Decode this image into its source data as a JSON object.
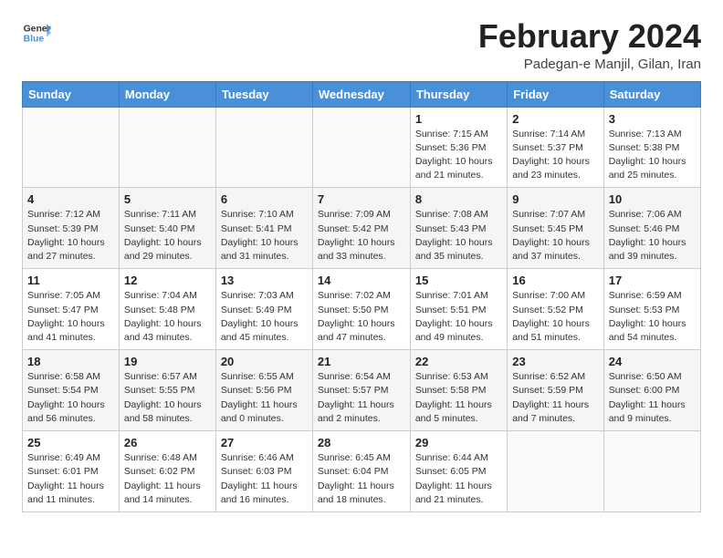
{
  "logo": {
    "general": "General",
    "blue": "Blue"
  },
  "header": {
    "month_year": "February 2024",
    "subtitle": "Padegan-e Manjil, Gilan, Iran"
  },
  "weekdays": [
    "Sunday",
    "Monday",
    "Tuesday",
    "Wednesday",
    "Thursday",
    "Friday",
    "Saturday"
  ],
  "weeks": [
    [
      {
        "day": "",
        "info": ""
      },
      {
        "day": "",
        "info": ""
      },
      {
        "day": "",
        "info": ""
      },
      {
        "day": "",
        "info": ""
      },
      {
        "day": "1",
        "info": "Sunrise: 7:15 AM\nSunset: 5:36 PM\nDaylight: 10 hours\nand 21 minutes."
      },
      {
        "day": "2",
        "info": "Sunrise: 7:14 AM\nSunset: 5:37 PM\nDaylight: 10 hours\nand 23 minutes."
      },
      {
        "day": "3",
        "info": "Sunrise: 7:13 AM\nSunset: 5:38 PM\nDaylight: 10 hours\nand 25 minutes."
      }
    ],
    [
      {
        "day": "4",
        "info": "Sunrise: 7:12 AM\nSunset: 5:39 PM\nDaylight: 10 hours\nand 27 minutes."
      },
      {
        "day": "5",
        "info": "Sunrise: 7:11 AM\nSunset: 5:40 PM\nDaylight: 10 hours\nand 29 minutes."
      },
      {
        "day": "6",
        "info": "Sunrise: 7:10 AM\nSunset: 5:41 PM\nDaylight: 10 hours\nand 31 minutes."
      },
      {
        "day": "7",
        "info": "Sunrise: 7:09 AM\nSunset: 5:42 PM\nDaylight: 10 hours\nand 33 minutes."
      },
      {
        "day": "8",
        "info": "Sunrise: 7:08 AM\nSunset: 5:43 PM\nDaylight: 10 hours\nand 35 minutes."
      },
      {
        "day": "9",
        "info": "Sunrise: 7:07 AM\nSunset: 5:45 PM\nDaylight: 10 hours\nand 37 minutes."
      },
      {
        "day": "10",
        "info": "Sunrise: 7:06 AM\nSunset: 5:46 PM\nDaylight: 10 hours\nand 39 minutes."
      }
    ],
    [
      {
        "day": "11",
        "info": "Sunrise: 7:05 AM\nSunset: 5:47 PM\nDaylight: 10 hours\nand 41 minutes."
      },
      {
        "day": "12",
        "info": "Sunrise: 7:04 AM\nSunset: 5:48 PM\nDaylight: 10 hours\nand 43 minutes."
      },
      {
        "day": "13",
        "info": "Sunrise: 7:03 AM\nSunset: 5:49 PM\nDaylight: 10 hours\nand 45 minutes."
      },
      {
        "day": "14",
        "info": "Sunrise: 7:02 AM\nSunset: 5:50 PM\nDaylight: 10 hours\nand 47 minutes."
      },
      {
        "day": "15",
        "info": "Sunrise: 7:01 AM\nSunset: 5:51 PM\nDaylight: 10 hours\nand 49 minutes."
      },
      {
        "day": "16",
        "info": "Sunrise: 7:00 AM\nSunset: 5:52 PM\nDaylight: 10 hours\nand 51 minutes."
      },
      {
        "day": "17",
        "info": "Sunrise: 6:59 AM\nSunset: 5:53 PM\nDaylight: 10 hours\nand 54 minutes."
      }
    ],
    [
      {
        "day": "18",
        "info": "Sunrise: 6:58 AM\nSunset: 5:54 PM\nDaylight: 10 hours\nand 56 minutes."
      },
      {
        "day": "19",
        "info": "Sunrise: 6:57 AM\nSunset: 5:55 PM\nDaylight: 10 hours\nand 58 minutes."
      },
      {
        "day": "20",
        "info": "Sunrise: 6:55 AM\nSunset: 5:56 PM\nDaylight: 11 hours\nand 0 minutes."
      },
      {
        "day": "21",
        "info": "Sunrise: 6:54 AM\nSunset: 5:57 PM\nDaylight: 11 hours\nand 2 minutes."
      },
      {
        "day": "22",
        "info": "Sunrise: 6:53 AM\nSunset: 5:58 PM\nDaylight: 11 hours\nand 5 minutes."
      },
      {
        "day": "23",
        "info": "Sunrise: 6:52 AM\nSunset: 5:59 PM\nDaylight: 11 hours\nand 7 minutes."
      },
      {
        "day": "24",
        "info": "Sunrise: 6:50 AM\nSunset: 6:00 PM\nDaylight: 11 hours\nand 9 minutes."
      }
    ],
    [
      {
        "day": "25",
        "info": "Sunrise: 6:49 AM\nSunset: 6:01 PM\nDaylight: 11 hours\nand 11 minutes."
      },
      {
        "day": "26",
        "info": "Sunrise: 6:48 AM\nSunset: 6:02 PM\nDaylight: 11 hours\nand 14 minutes."
      },
      {
        "day": "27",
        "info": "Sunrise: 6:46 AM\nSunset: 6:03 PM\nDaylight: 11 hours\nand 16 minutes."
      },
      {
        "day": "28",
        "info": "Sunrise: 6:45 AM\nSunset: 6:04 PM\nDaylight: 11 hours\nand 18 minutes."
      },
      {
        "day": "29",
        "info": "Sunrise: 6:44 AM\nSunset: 6:05 PM\nDaylight: 11 hours\nand 21 minutes."
      },
      {
        "day": "",
        "info": ""
      },
      {
        "day": "",
        "info": ""
      }
    ]
  ]
}
